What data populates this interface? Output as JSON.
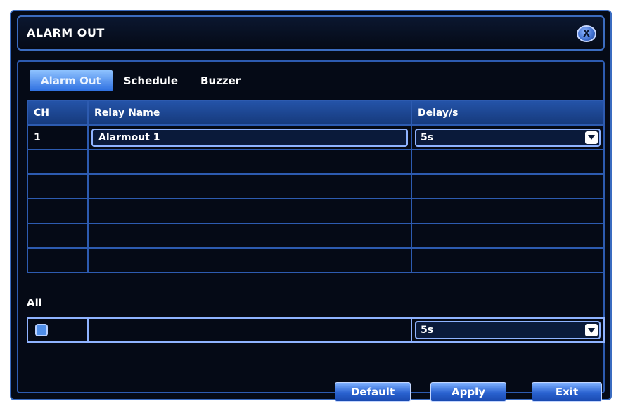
{
  "window": {
    "title": "ALARM OUT",
    "close_icon": "close-icon"
  },
  "tabs": [
    {
      "label": "Alarm Out",
      "active": true
    },
    {
      "label": "Schedule",
      "active": false
    },
    {
      "label": "Buzzer",
      "active": false
    }
  ],
  "table": {
    "headers": [
      "CH",
      "Relay Name",
      "Delay/s"
    ],
    "rows": [
      {
        "ch": "1",
        "relay_name": "Alarmout 1",
        "delay": "5s"
      }
    ],
    "empty_rows": 5
  },
  "all": {
    "label": "All",
    "delay": "5s"
  },
  "buttons": {
    "default": "Default",
    "apply": "Apply",
    "exit": "Exit"
  },
  "colors": {
    "background": "#050a16",
    "accent": "#2d5bb0",
    "tab_active": "#2c6ee0",
    "button": "#2a62d0"
  }
}
